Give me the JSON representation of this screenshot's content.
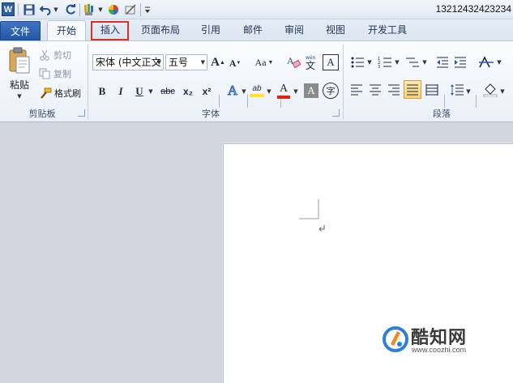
{
  "titlebar": {
    "logo_letter": "W",
    "title": "13212432423234"
  },
  "tabs": {
    "file": "文件",
    "home": "开始",
    "insert": "插入",
    "page_layout": "页面布局",
    "references": "引用",
    "mailings": "邮件",
    "review": "审阅",
    "view": "视图",
    "developer": "开发工具"
  },
  "clipboard": {
    "paste": "粘贴",
    "cut": "剪切",
    "copy": "复制",
    "format_painter": "格式刷",
    "group_label": "剪贴板"
  },
  "font": {
    "font_name": "宋体 (中文正文",
    "font_size": "五号",
    "group_label": "字体",
    "bold": "B",
    "italic": "I",
    "underline": "U",
    "strike": "abc",
    "aa": "Aa",
    "sub": "x₂",
    "sup": "x²",
    "text_effect": "A",
    "highlight": "ab",
    "font_color": "A",
    "char_shading": "A",
    "enclose": "字",
    "grow": "A",
    "shrink": "A",
    "clear_format": "A",
    "phonetic": "文",
    "border": "A"
  },
  "paragraph": {
    "group_label": "段落"
  },
  "watermark": {
    "name": "酷知网",
    "url": "www.coozhi.com"
  },
  "colors": {
    "accent": "#2457a6",
    "highlight_red": "#d9302b",
    "font_color_red": "#e0201b",
    "highlight_yellow": "#ffe033",
    "justify_active": "#f7d27a"
  }
}
